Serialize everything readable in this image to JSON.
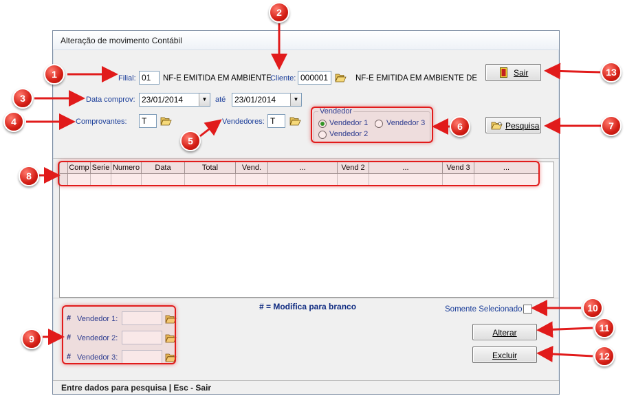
{
  "window": {
    "title": "Alteração de movimento Contábil"
  },
  "filial": {
    "label": "Filial:",
    "value": "01",
    "desc": "NF-E EMITIDA EM AMBIENTE"
  },
  "cliente": {
    "label": "Cliente:",
    "value": "000001",
    "desc": "NF-E EMITIDA EM AMBIENTE DE"
  },
  "data": {
    "label": "Data comprov:",
    "from": "23/01/2014",
    "sep": "até",
    "to": "23/01/2014"
  },
  "comprovantes": {
    "label": "Comprovantes:",
    "value": "T"
  },
  "vendedores": {
    "label": "Vendedores:",
    "value": "T"
  },
  "vendedor_group": {
    "legend": "Vendedor",
    "options": [
      "Vendedor 1",
      "Vendedor 3",
      "Vendedor 2"
    ],
    "selected": "Vendedor 1"
  },
  "buttons": {
    "sair": "Sair",
    "pesquisa": "Pesquisa",
    "alterar": "Alterar",
    "excluir": "Excluir"
  },
  "grid": {
    "columns": [
      "Comp",
      "Serie",
      "Numero",
      "Data",
      "Total",
      "Vend.",
      "...",
      "Vend 2",
      "...",
      "Vend 3",
      "..."
    ]
  },
  "bottom": {
    "note": "# = Modifica para branco",
    "hash": "#",
    "v1_label": "Vendedor 1:",
    "v2_label": "Vendedor 2:",
    "v3_label": "Vendedor 3:",
    "somente": "Somente Selecionado"
  },
  "status": "Entre dados para pesquisa | Esc - Sair",
  "annotations": [
    "1",
    "2",
    "3",
    "4",
    "5",
    "6",
    "7",
    "8",
    "9",
    "10",
    "11",
    "12",
    "13"
  ],
  "colors": {
    "annotation": "#e11b1b",
    "label_blue": "#1a3d99",
    "radio_selected": "#1fa024"
  }
}
